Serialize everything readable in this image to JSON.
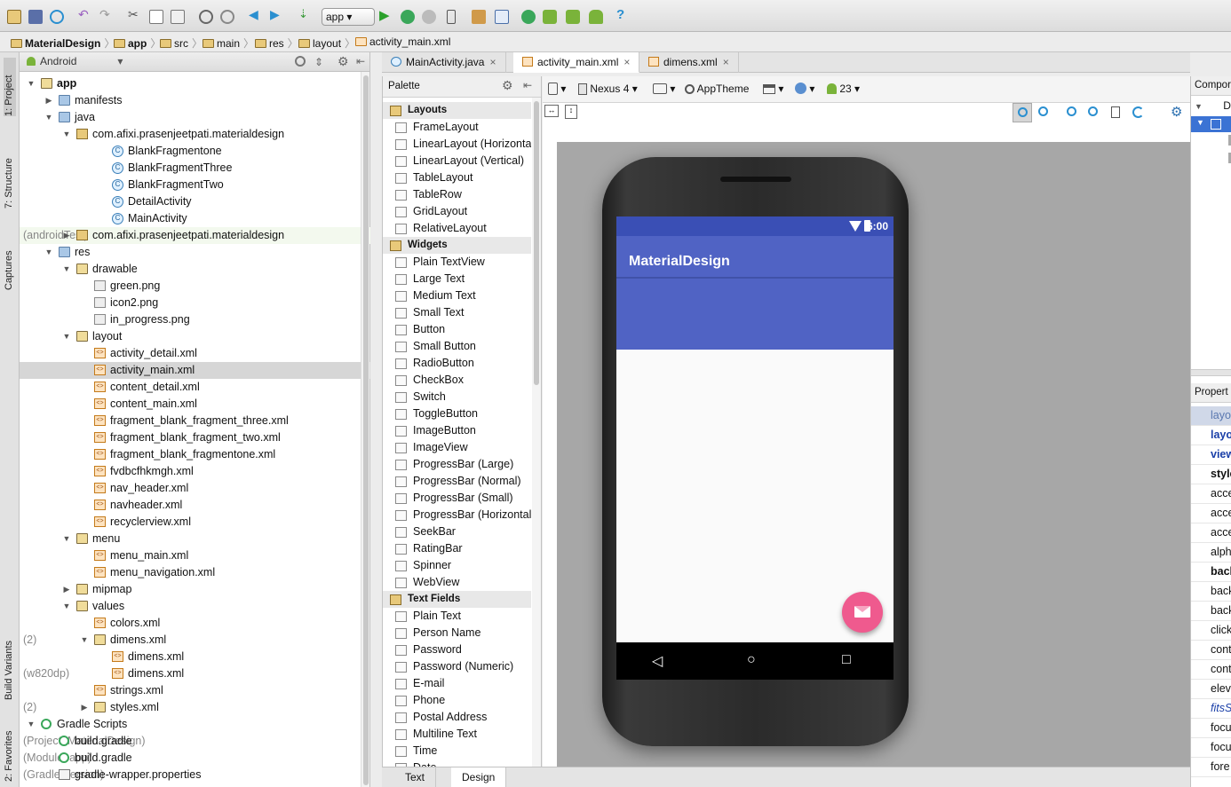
{
  "toolbar": {
    "run_config": "app"
  },
  "breadcrumb": [
    "MaterialDesign",
    "app",
    "src",
    "main",
    "res",
    "layout",
    "activity_main.xml"
  ],
  "side_tabs": {
    "project": "1: Project",
    "structure": "7: Structure",
    "captures": "Captures",
    "build_variants": "Build Variants",
    "favorites": "2: Favorites"
  },
  "project": {
    "view_selector": "Android",
    "tree": [
      {
        "label": "app",
        "icon": "folder-icon",
        "arrow": "▼",
        "indent": 0,
        "bold": true
      },
      {
        "label": "manifests",
        "icon": "folder-icon",
        "arrow": "▶",
        "indent": 1
      },
      {
        "label": "java",
        "icon": "folder-icon",
        "arrow": "▼",
        "indent": 1
      },
      {
        "label": "com.afixi.prasenjeetpati.materialdesign",
        "icon": "package-icon",
        "arrow": "▼",
        "indent": 2
      },
      {
        "label": "BlankFragmentone",
        "icon": "class-icon",
        "indent": 4
      },
      {
        "label": "BlankFragmentThree",
        "icon": "class-icon",
        "indent": 4
      },
      {
        "label": "BlankFragmentTwo",
        "icon": "class-icon",
        "indent": 4
      },
      {
        "label": "DetailActivity",
        "icon": "class-icon",
        "indent": 4
      },
      {
        "label": "MainActivity",
        "icon": "class-icon",
        "indent": 4
      },
      {
        "label": "com.afixi.prasenjeetpati.materialdesign",
        "suffix": "(androidTest)",
        "icon": "package-icon",
        "arrow": "▶",
        "indent": 2,
        "hl": true
      },
      {
        "label": "res",
        "icon": "folder-icon",
        "arrow": "▼",
        "indent": 1
      },
      {
        "label": "drawable",
        "icon": "folder-icon",
        "arrow": "▼",
        "indent": 2
      },
      {
        "label": "green.png",
        "icon": "image-file-icon",
        "indent": 3
      },
      {
        "label": "icon2.png",
        "icon": "image-file-icon",
        "indent": 3
      },
      {
        "label": "in_progress.png",
        "icon": "image-file-icon",
        "indent": 3
      },
      {
        "label": "layout",
        "icon": "folder-icon",
        "arrow": "▼",
        "indent": 2
      },
      {
        "label": "activity_detail.xml",
        "icon": "xml-file-icon",
        "indent": 3
      },
      {
        "label": "activity_main.xml",
        "icon": "xml-file-icon",
        "indent": 3,
        "selected": true
      },
      {
        "label": "content_detail.xml",
        "icon": "xml-file-icon",
        "indent": 3
      },
      {
        "label": "content_main.xml",
        "icon": "xml-file-icon",
        "indent": 3
      },
      {
        "label": "fragment_blank_fragment_three.xml",
        "icon": "xml-file-icon",
        "indent": 3
      },
      {
        "label": "fragment_blank_fragment_two.xml",
        "icon": "xml-file-icon",
        "indent": 3
      },
      {
        "label": "fragment_blank_fragmentone.xml",
        "icon": "xml-file-icon",
        "indent": 3
      },
      {
        "label": "fvdbcfhkmgh.xml",
        "icon": "xml-file-icon",
        "indent": 3
      },
      {
        "label": "nav_header.xml",
        "icon": "xml-file-icon",
        "indent": 3
      },
      {
        "label": "navheader.xml",
        "icon": "xml-file-icon",
        "indent": 3
      },
      {
        "label": "recyclerview.xml",
        "icon": "xml-file-icon",
        "indent": 3
      },
      {
        "label": "menu",
        "icon": "folder-icon",
        "arrow": "▼",
        "indent": 2
      },
      {
        "label": "menu_main.xml",
        "icon": "xml-file-icon",
        "indent": 3
      },
      {
        "label": "menu_navigation.xml",
        "icon": "xml-file-icon",
        "indent": 3
      },
      {
        "label": "mipmap",
        "icon": "folder-icon",
        "arrow": "▶",
        "indent": 2
      },
      {
        "label": "values",
        "icon": "folder-icon",
        "arrow": "▼",
        "indent": 2
      },
      {
        "label": "colors.xml",
        "icon": "xml-file-icon",
        "indent": 3
      },
      {
        "label": "dimens.xml",
        "suffix": "(2)",
        "icon": "folder-icon",
        "arrow": "▼",
        "indent": 3
      },
      {
        "label": "dimens.xml",
        "icon": "xml-file-icon",
        "indent": 4
      },
      {
        "label": "dimens.xml",
        "suffix": "(w820dp)",
        "icon": "xml-file-icon",
        "indent": 4
      },
      {
        "label": "strings.xml",
        "icon": "xml-file-icon",
        "indent": 3
      },
      {
        "label": "styles.xml",
        "suffix": "(2)",
        "icon": "folder-icon",
        "arrow": "▶",
        "indent": 3
      },
      {
        "label": "Gradle Scripts",
        "icon": "gradle-icon",
        "arrow": "▼",
        "indent": 0
      },
      {
        "label": "build.gradle",
        "suffix": "(Project: MaterialDesign)",
        "icon": "gradle-icon",
        "indent": 1
      },
      {
        "label": "build.gradle",
        "suffix": "(Module: app)",
        "icon": "gradle-icon",
        "indent": 1
      },
      {
        "label": "gradle-wrapper.properties",
        "suffix": "(Gradle Version)",
        "icon": "properties-file-icon",
        "indent": 1
      }
    ]
  },
  "editor_tabs": [
    {
      "label": "MainActivity.java",
      "active": false
    },
    {
      "label": "activity_main.xml",
      "active": true
    },
    {
      "label": "dimens.xml",
      "active": false
    }
  ],
  "palette": {
    "title": "Palette",
    "items": [
      {
        "label": "Layouts",
        "cat": true
      },
      {
        "label": "FrameLayout"
      },
      {
        "label": "LinearLayout (Horizontal)"
      },
      {
        "label": "LinearLayout (Vertical)"
      },
      {
        "label": "TableLayout"
      },
      {
        "label": "TableRow"
      },
      {
        "label": "GridLayout"
      },
      {
        "label": "RelativeLayout"
      },
      {
        "label": "Widgets",
        "cat": true
      },
      {
        "label": "Plain TextView"
      },
      {
        "label": "Large Text"
      },
      {
        "label": "Medium Text"
      },
      {
        "label": "Small Text"
      },
      {
        "label": "Button"
      },
      {
        "label": "Small Button"
      },
      {
        "label": "RadioButton"
      },
      {
        "label": "CheckBox"
      },
      {
        "label": "Switch"
      },
      {
        "label": "ToggleButton"
      },
      {
        "label": "ImageButton"
      },
      {
        "label": "ImageView"
      },
      {
        "label": "ProgressBar (Large)"
      },
      {
        "label": "ProgressBar (Normal)"
      },
      {
        "label": "ProgressBar (Small)"
      },
      {
        "label": "ProgressBar (Horizontal)"
      },
      {
        "label": "SeekBar"
      },
      {
        "label": "RatingBar"
      },
      {
        "label": "Spinner"
      },
      {
        "label": "WebView"
      },
      {
        "label": "Text Fields",
        "cat": true
      },
      {
        "label": "Plain Text"
      },
      {
        "label": "Person Name"
      },
      {
        "label": "Password"
      },
      {
        "label": "Password (Numeric)"
      },
      {
        "label": "E-mail"
      },
      {
        "label": "Phone"
      },
      {
        "label": "Postal Address"
      },
      {
        "label": "Multiline Text"
      },
      {
        "label": "Time"
      },
      {
        "label": "Date"
      }
    ]
  },
  "designer_toolbar": {
    "device": "Nexus 4",
    "theme": "AppTheme",
    "api": "23"
  },
  "preview": {
    "status_time": "6:00",
    "app_title": "MaterialDesign",
    "nav_back": "◁",
    "nav_home": "○",
    "nav_recent": "□"
  },
  "right": {
    "component_title": "Compor",
    "component_row": "D",
    "properties_title": "Propert",
    "properties": [
      {
        "label": "layo",
        "style": "sel"
      },
      {
        "label": "layo",
        "style": "blue"
      },
      {
        "label": "view",
        "style": "blue"
      },
      {
        "label": "style",
        "style": "b"
      },
      {
        "label": "acce"
      },
      {
        "label": "acce"
      },
      {
        "label": "acce"
      },
      {
        "label": "alph"
      },
      {
        "label": "back",
        "style": "b"
      },
      {
        "label": "back"
      },
      {
        "label": "back"
      },
      {
        "label": "click"
      },
      {
        "label": "cont"
      },
      {
        "label": "cont"
      },
      {
        "label": "eleva"
      },
      {
        "label": "fitsS",
        "style": "it"
      },
      {
        "label": "focu"
      },
      {
        "label": "focu"
      },
      {
        "label": "fore"
      }
    ]
  },
  "bottom_tabs": [
    {
      "label": "Text",
      "active": false
    },
    {
      "label": "Design",
      "active": true
    }
  ]
}
